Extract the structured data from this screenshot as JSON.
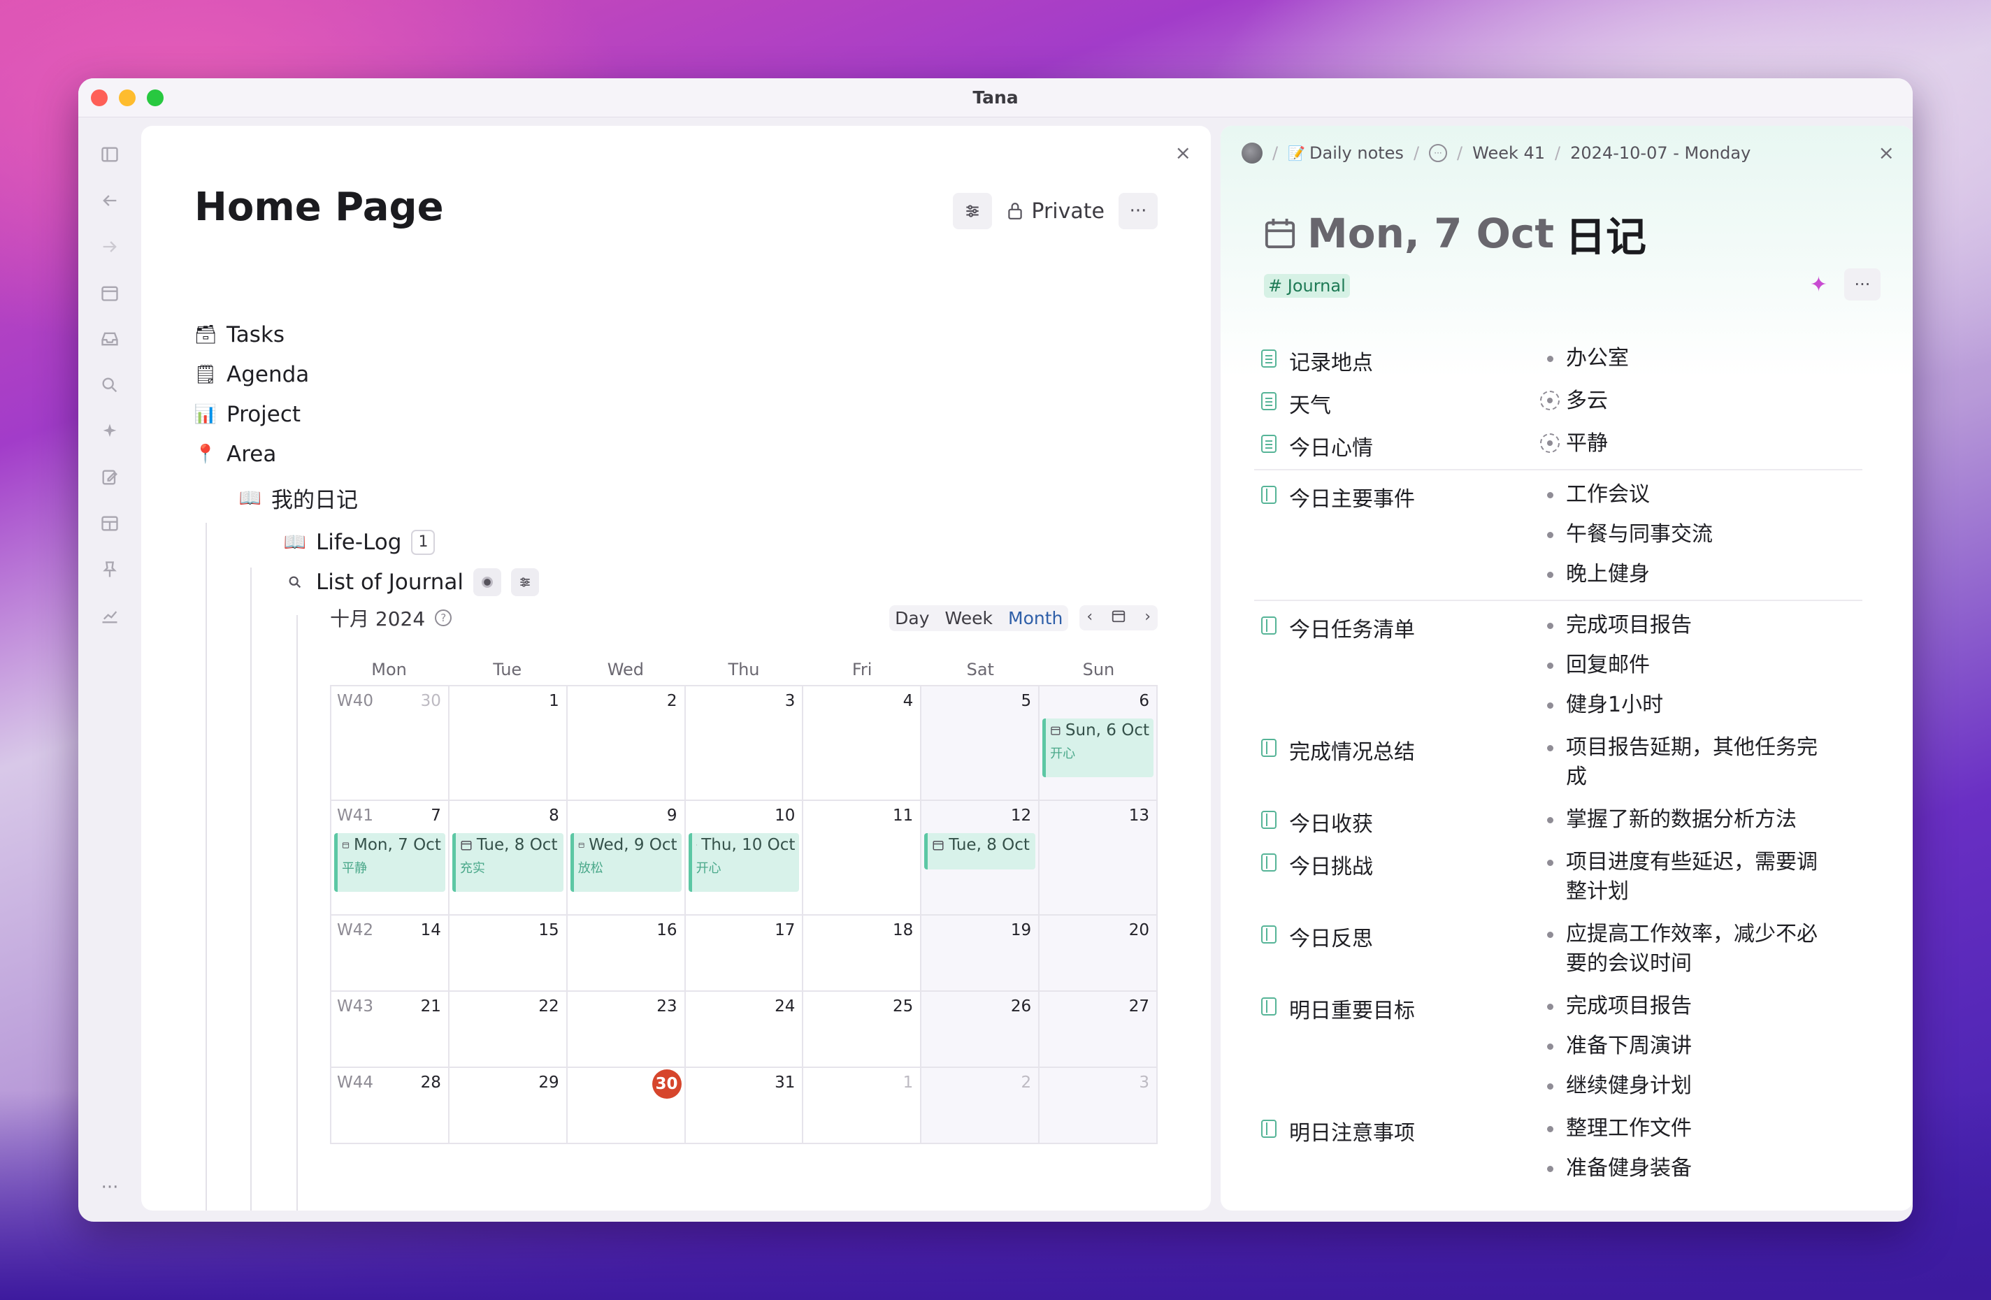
{
  "window": {
    "title": "Tana"
  },
  "sidebar": {
    "icons": [
      "sidebar-toggle-icon",
      "back-arrow-icon",
      "forward-arrow-icon",
      "calendar-icon",
      "inbox-icon",
      "search-icon",
      "sparkle-icon",
      "edit-icon",
      "layout-icon",
      "pin-icon",
      "chart-icon"
    ],
    "more": "···"
  },
  "left": {
    "close": "×",
    "title": "Home Page",
    "private_label": "Private",
    "more": "···",
    "tree": {
      "tasks": "Tasks",
      "agenda": "Agenda",
      "project": "Project",
      "area": "Area",
      "my_diary": "我的日记",
      "lifelog": "Life-Log",
      "lifelog_count": "1",
      "list_journal": "List of Journal"
    },
    "calendar": {
      "month_label": "十月 2024",
      "views": {
        "day": "Day",
        "week": "Week",
        "month": "Month",
        "active": "Month"
      },
      "weekdays": [
        "Mon",
        "Tue",
        "Wed",
        "Thu",
        "Fri",
        "Sat",
        "Sun"
      ],
      "weeks": [
        {
          "label": "W40",
          "days": [
            {
              "n": "30",
              "muted": true
            },
            {
              "n": "1"
            },
            {
              "n": "2"
            },
            {
              "n": "3"
            },
            {
              "n": "4"
            },
            {
              "n": "5"
            },
            {
              "n": "6",
              "event": {
                "title": "Sun, 6 Oct",
                "sub": "开心"
              }
            }
          ]
        },
        {
          "label": "W41",
          "days": [
            {
              "n": "7",
              "event": {
                "title": "Mon, 7 Oct",
                "sub": "平静"
              }
            },
            {
              "n": "8",
              "event": {
                "title": "Tue, 8 Oct",
                "sub": "充实"
              }
            },
            {
              "n": "9",
              "event": {
                "title": "Wed, 9 Oct",
                "sub": "放松"
              }
            },
            {
              "n": "10",
              "event": {
                "title": "Thu, 10 Oct",
                "sub": "开心"
              }
            },
            {
              "n": "11"
            },
            {
              "n": "12",
              "event": {
                "title": "Tue, 8 Oct",
                "sub": ""
              }
            },
            {
              "n": "13"
            }
          ]
        },
        {
          "label": "W42",
          "days": [
            {
              "n": "14"
            },
            {
              "n": "15"
            },
            {
              "n": "16"
            },
            {
              "n": "17"
            },
            {
              "n": "18"
            },
            {
              "n": "19"
            },
            {
              "n": "20"
            }
          ]
        },
        {
          "label": "W43",
          "days": [
            {
              "n": "21"
            },
            {
              "n": "22"
            },
            {
              "n": "23"
            },
            {
              "n": "24"
            },
            {
              "n": "25"
            },
            {
              "n": "26"
            },
            {
              "n": "27"
            }
          ]
        },
        {
          "label": "W44",
          "days": [
            {
              "n": "28"
            },
            {
              "n": "29"
            },
            {
              "n": "30",
              "today": true
            },
            {
              "n": "31"
            },
            {
              "n": "1",
              "muted": true
            },
            {
              "n": "2",
              "muted": true
            },
            {
              "n": "3",
              "muted": true
            }
          ]
        }
      ]
    }
  },
  "right": {
    "breadcrumb": {
      "daily_notes": "Daily notes",
      "week": "Week 41",
      "date": "2024-10-07 - Monday"
    },
    "close": "×",
    "title_date": "Mon, 7 Oct",
    "title_suffix": "日记",
    "tag": "# Journal",
    "more": "···",
    "fields": [
      {
        "name": "记录地点",
        "icon": "list",
        "values": [
          {
            "t": "办公室",
            "b": "dot"
          }
        ]
      },
      {
        "name": "天气",
        "icon": "list",
        "values": [
          {
            "t": "多云",
            "b": "ring"
          }
        ]
      },
      {
        "name": "今日心情",
        "icon": "list",
        "values": [
          {
            "t": "平静",
            "b": "ring"
          }
        ]
      },
      {
        "name": "今日主要事件",
        "icon": "side",
        "divider": true,
        "values": [
          {
            "t": "工作会议",
            "b": "dot"
          },
          {
            "t": "午餐与同事交流",
            "b": "dot"
          },
          {
            "t": "晚上健身",
            "b": "dot"
          }
        ]
      },
      {
        "name": "今日任务清单",
        "icon": "side",
        "divider": true,
        "values": [
          {
            "t": "完成项目报告",
            "b": "dot"
          },
          {
            "t": "回复邮件",
            "b": "dot"
          },
          {
            "t": "健身1小时",
            "b": "dot"
          }
        ]
      },
      {
        "name": "完成情况总结",
        "icon": "side",
        "values": [
          {
            "t": "项目报告延期，其他任务完成",
            "b": "dot"
          }
        ]
      },
      {
        "name": "今日收获",
        "icon": "side",
        "values": [
          {
            "t": "掌握了新的数据分析方法",
            "b": "dot"
          }
        ]
      },
      {
        "name": "今日挑战",
        "icon": "side",
        "values": [
          {
            "t": "项目进度有些延迟，需要调整计划",
            "b": "dot"
          }
        ]
      },
      {
        "name": "今日反思",
        "icon": "side",
        "values": [
          {
            "t": "应提高工作效率，减少不必要的会议时间",
            "b": "dot"
          }
        ]
      },
      {
        "name": "明日重要目标",
        "icon": "side",
        "values": [
          {
            "t": "完成项目报告",
            "b": "dot"
          },
          {
            "t": "准备下周演讲",
            "b": "dot"
          },
          {
            "t": "继续健身计划",
            "b": "dot"
          }
        ]
      },
      {
        "name": "明日注意事项",
        "icon": "side",
        "values": [
          {
            "t": "整理工作文件",
            "b": "dot"
          },
          {
            "t": "准备健身装备",
            "b": "dot"
          }
        ]
      }
    ]
  }
}
